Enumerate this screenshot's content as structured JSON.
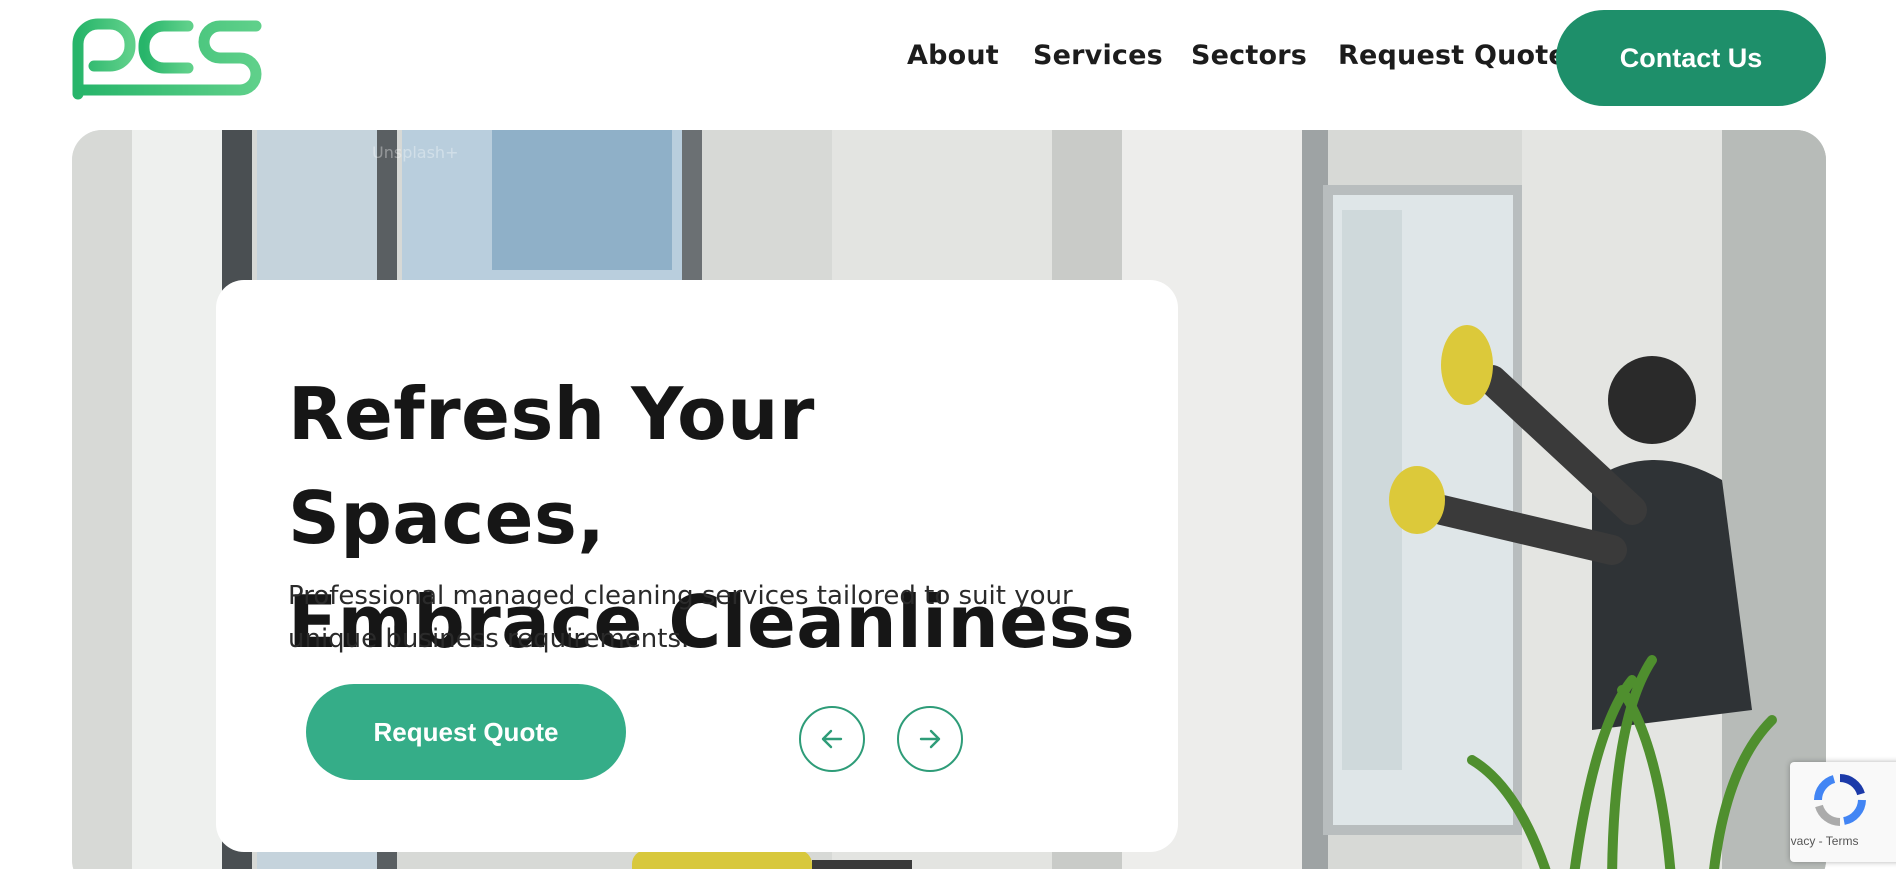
{
  "brand": {
    "logo_text": "pcs",
    "primary_color": "#1e8f6a",
    "accent_color": "#35ad88"
  },
  "nav": {
    "links": [
      {
        "label": "About"
      },
      {
        "label": "Services"
      },
      {
        "label": "Sectors"
      },
      {
        "label": "Request Quote"
      }
    ],
    "contact_label": "Contact Us"
  },
  "hero": {
    "headline_line1": "Refresh Your Spaces,",
    "headline_line2": "Embrace Cleanliness",
    "subtext": "Professional managed cleaning services tailored to suit your unique business requirements.",
    "cta_label": "Request Quote",
    "prev_icon": "arrow-left-icon",
    "next_icon": "arrow-right-icon",
    "watermark": "Unsplash+"
  },
  "recaptcha": {
    "links_text": "Privacy - Terms"
  }
}
